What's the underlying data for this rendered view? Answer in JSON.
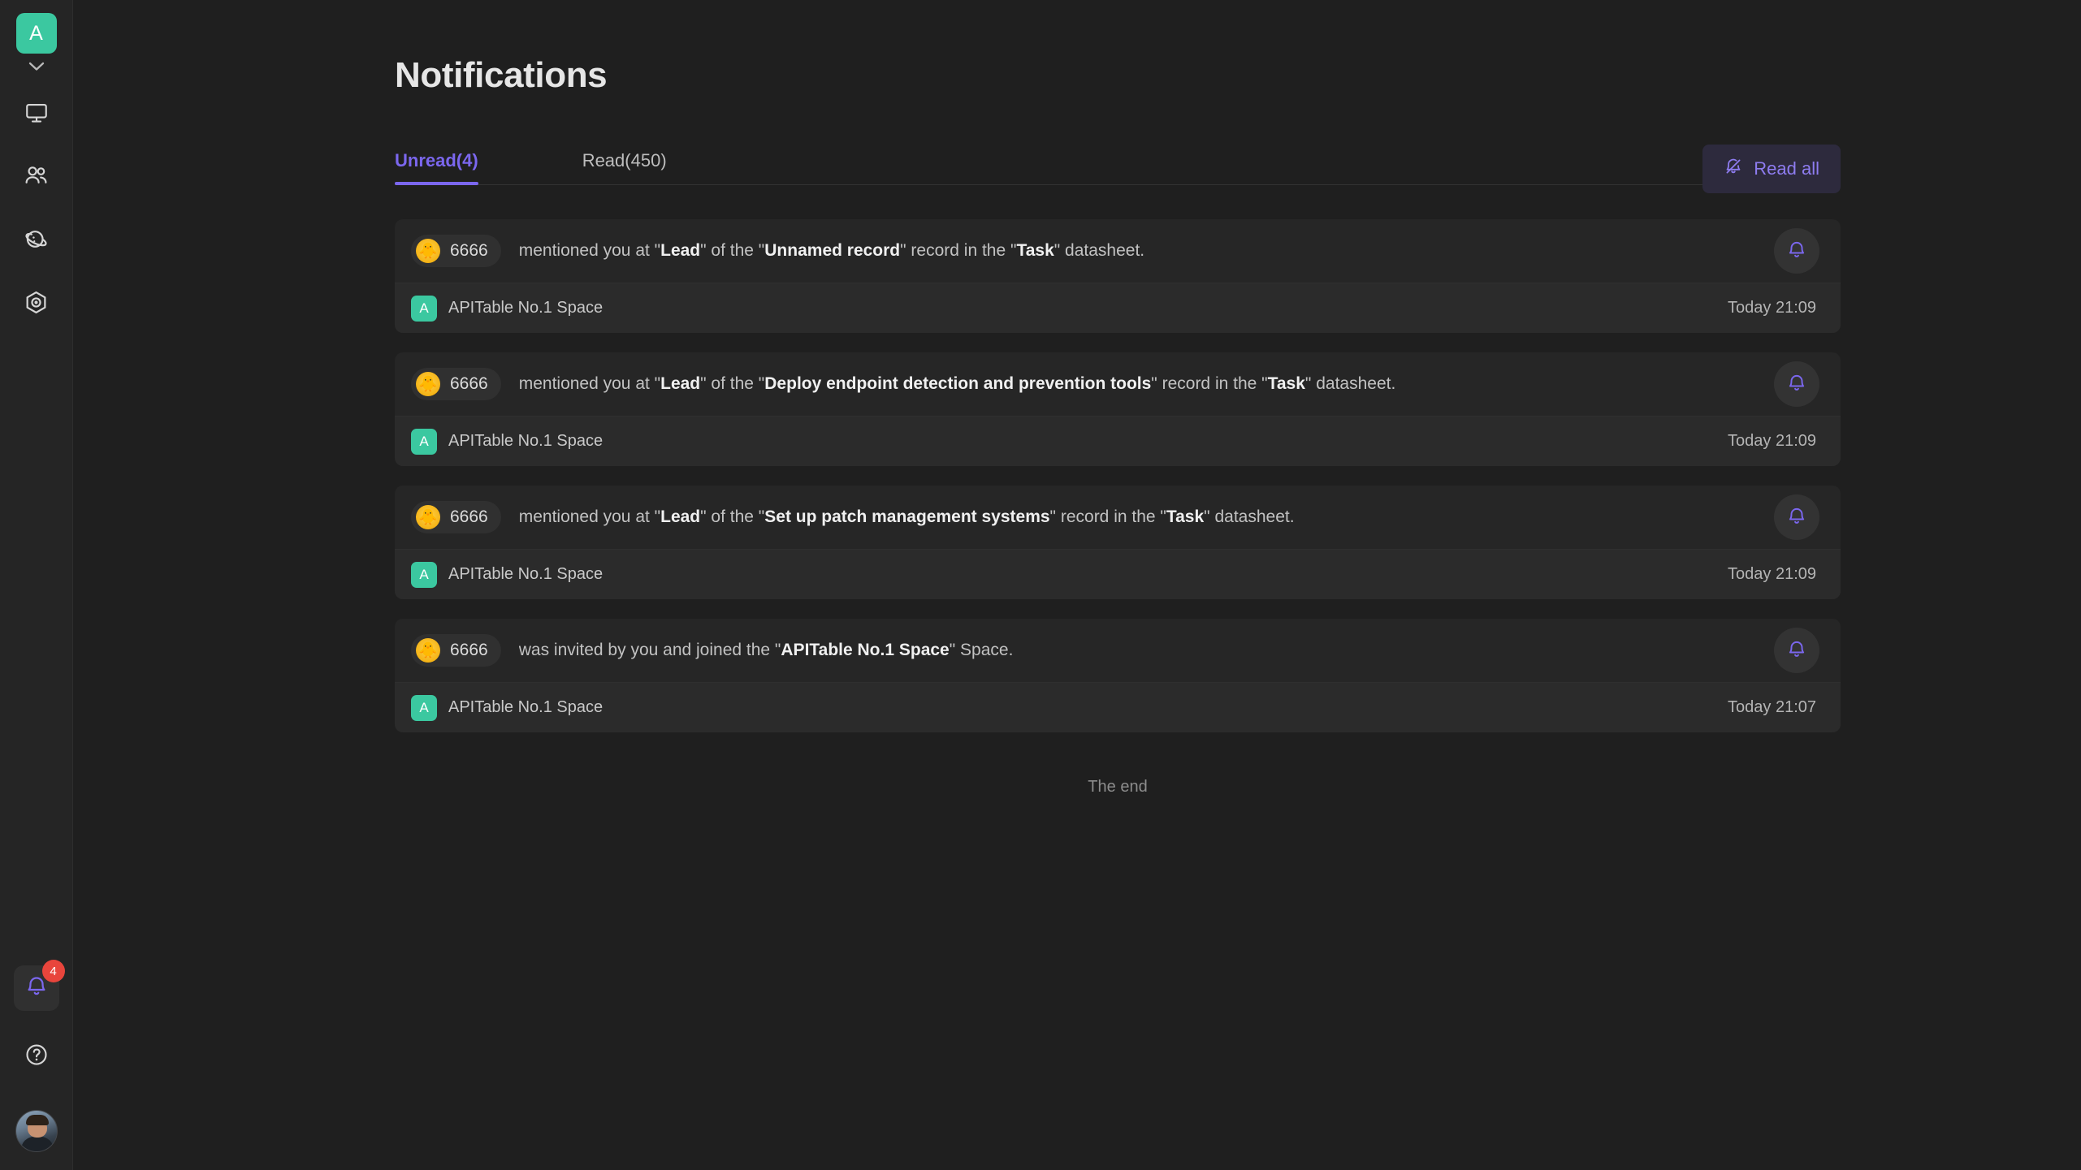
{
  "sidebar": {
    "workspace_avatar_letter": "A",
    "workspace_expand_icon": "chevron-down-icon",
    "nav_items": [
      {
        "icon": "monitor-icon",
        "name": "workbench"
      },
      {
        "icon": "users-icon",
        "name": "org"
      },
      {
        "icon": "planet-icon",
        "name": "template"
      },
      {
        "icon": "hexagon-target-icon",
        "name": "automation"
      }
    ],
    "notification_badge_count": "4",
    "notification_icon": "bell-icon",
    "help_icon": "question-circle-icon",
    "user_avatar": "user-photo-avatar"
  },
  "header": {
    "title": "Notifications"
  },
  "tabs": [
    {
      "label": "Unread(4)",
      "active": true,
      "name": "tab-unread"
    },
    {
      "label": "Read(450)",
      "active": false,
      "name": "tab-read"
    }
  ],
  "toolbar": {
    "read_all_label": "Read all",
    "read_all_icon": "bell-slash-icon"
  },
  "notifications": [
    {
      "user": "6666",
      "avatar_emoji": "🐥",
      "message_parts": [
        {
          "text": "mentioned you at \"",
          "bold": false
        },
        {
          "text": "Lead",
          "bold": true
        },
        {
          "text": "\" of the \"",
          "bold": false
        },
        {
          "text": "Unnamed record",
          "bold": true
        },
        {
          "text": "\" record in the \"",
          "bold": false
        },
        {
          "text": "Task",
          "bold": true
        },
        {
          "text": "\" datasheet.",
          "bold": false
        }
      ],
      "space_badge": "A",
      "space_name": "APITable No.1 Space",
      "time": "Today 21:09",
      "action_icon": "bell-icon"
    },
    {
      "user": "6666",
      "avatar_emoji": "🐥",
      "message_parts": [
        {
          "text": "mentioned you at \"",
          "bold": false
        },
        {
          "text": "Lead",
          "bold": true
        },
        {
          "text": "\" of the \"",
          "bold": false
        },
        {
          "text": "Deploy endpoint detection and prevention tools",
          "bold": true
        },
        {
          "text": "\" record in the \"",
          "bold": false
        },
        {
          "text": "Task",
          "bold": true
        },
        {
          "text": "\" datasheet.",
          "bold": false
        }
      ],
      "space_badge": "A",
      "space_name": "APITable No.1 Space",
      "time": "Today 21:09",
      "action_icon": "bell-icon"
    },
    {
      "user": "6666",
      "avatar_emoji": "🐥",
      "message_parts": [
        {
          "text": "mentioned you at \"",
          "bold": false
        },
        {
          "text": "Lead",
          "bold": true
        },
        {
          "text": "\" of the \"",
          "bold": false
        },
        {
          "text": "Set up patch management systems",
          "bold": true
        },
        {
          "text": "\" record in the \"",
          "bold": false
        },
        {
          "text": "Task",
          "bold": true
        },
        {
          "text": "\" datasheet.",
          "bold": false
        }
      ],
      "space_badge": "A",
      "space_name": "APITable No.1 Space",
      "time": "Today 21:09",
      "action_icon": "bell-icon"
    },
    {
      "user": "6666",
      "avatar_emoji": "🐥",
      "message_parts": [
        {
          "text": "was invited by you and joined the \"",
          "bold": false
        },
        {
          "text": "APITable No.1 Space",
          "bold": true
        },
        {
          "text": "\" Space.",
          "bold": false
        }
      ],
      "space_badge": "A",
      "space_name": "APITable No.1 Space",
      "time": "Today 21:07",
      "action_icon": "bell-icon"
    }
  ],
  "footer": {
    "end_text": "The end"
  },
  "colors": {
    "accent_purple": "#7b67ee",
    "brand_green": "#3bc8a0",
    "badge_red": "#e8453c",
    "page_bg": "#1f1f1f",
    "sidebar_bg": "#252525",
    "card_bg": "#262626"
  }
}
